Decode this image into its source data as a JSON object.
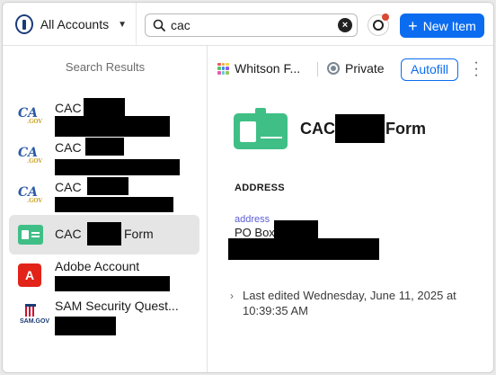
{
  "header": {
    "account_label": "All Accounts",
    "search_value": "cac",
    "new_item_label": "New Item"
  },
  "results": {
    "header": "Search Results",
    "items": [
      {
        "title": "CAC",
        "icon": "cac-gov-logo-icon"
      },
      {
        "title": "CAC",
        "icon": "cac-gov-logo-icon"
      },
      {
        "title": "CAC",
        "icon": "cac-gov-logo-icon"
      },
      {
        "title_prefix": "CAC",
        "title_suffix": "Form",
        "icon": "id-card-icon",
        "selected": true
      },
      {
        "title": "Adobe Account",
        "icon": "adobe-logo-icon"
      },
      {
        "title": "SAM Security Quest...",
        "icon": "sam-gov-logo-icon"
      }
    ]
  },
  "detail": {
    "vault_name": "Whitson F...",
    "visibility": "Private",
    "autofill_label": "Autofill",
    "title_prefix": "CAC",
    "title_suffix": "Form",
    "section_label": "ADDRESS",
    "field_label": "address",
    "field_value_prefix": "PO Box",
    "last_edited_line1": "Last edited Wednesday, June 11, 2025 at",
    "last_edited_line2": "10:39:35 AM"
  },
  "colors": {
    "accent": "#0b6cf0",
    "id_green": "#3fbf86",
    "selected_bg": "#e5e5e5",
    "field_label": "#5b5bd6",
    "adobe_red": "#e2231a",
    "notification_dot": "#d94a33"
  }
}
